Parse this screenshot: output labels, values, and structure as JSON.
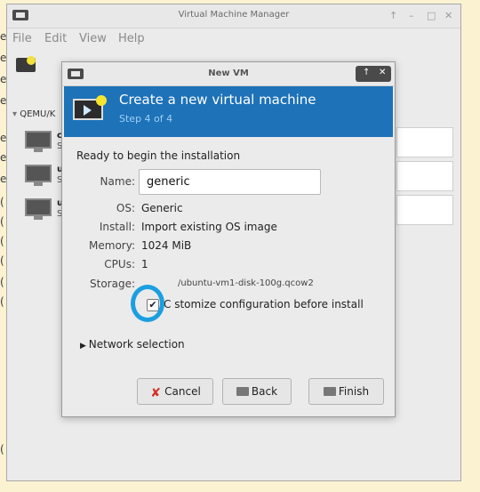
{
  "desktop": {
    "glyphs": [
      "e",
      "e",
      "e",
      "e",
      "e",
      "e",
      "e",
      "(",
      "(",
      "(",
      "(",
      "(",
      "(",
      "(",
      "(",
      "(",
      "("
    ]
  },
  "main_window": {
    "title": "Virtual Machine Manager",
    "controls": {
      "up": "↑",
      "minimize": "–",
      "maximize": "□",
      "close": "✕"
    },
    "menu": [
      "File",
      "Edit",
      "View",
      "Help"
    ],
    "sidebar": {
      "connection": "QEMU/K",
      "items": [
        {
          "name": "c",
          "sub": "S"
        },
        {
          "name": "u",
          "sub": "S"
        },
        {
          "name": "u",
          "sub": "S"
        }
      ]
    }
  },
  "dialog": {
    "title": "New VM",
    "controls": {
      "up": "↑",
      "close": "✕"
    },
    "banner_title": "Create a new virtual machine",
    "banner_step": "Step 4 of 4",
    "ready_text": "Ready to begin the installation",
    "name_label": "Name:",
    "name_value": "generic",
    "os_label": "OS:",
    "os_value": "Generic",
    "install_label": "Install:",
    "install_value": "Import existing OS image",
    "memory_label": "Memory:",
    "memory_value": "1024 MiB",
    "cpus_label": "CPUs:",
    "cpus_value": "1",
    "storage_label": "Storage:",
    "storage_value": "/ubuntu-vm1-disk-100g.qcow2",
    "customize_checked": true,
    "customize_label": "C  stomize configuration before install",
    "network_label": "Network selection",
    "cancel_label": "Cancel",
    "back_label": "Back",
    "finish_label": "Finish",
    "highlight_color": "#1b9fe0",
    "banner_color": "#1d72b8"
  }
}
